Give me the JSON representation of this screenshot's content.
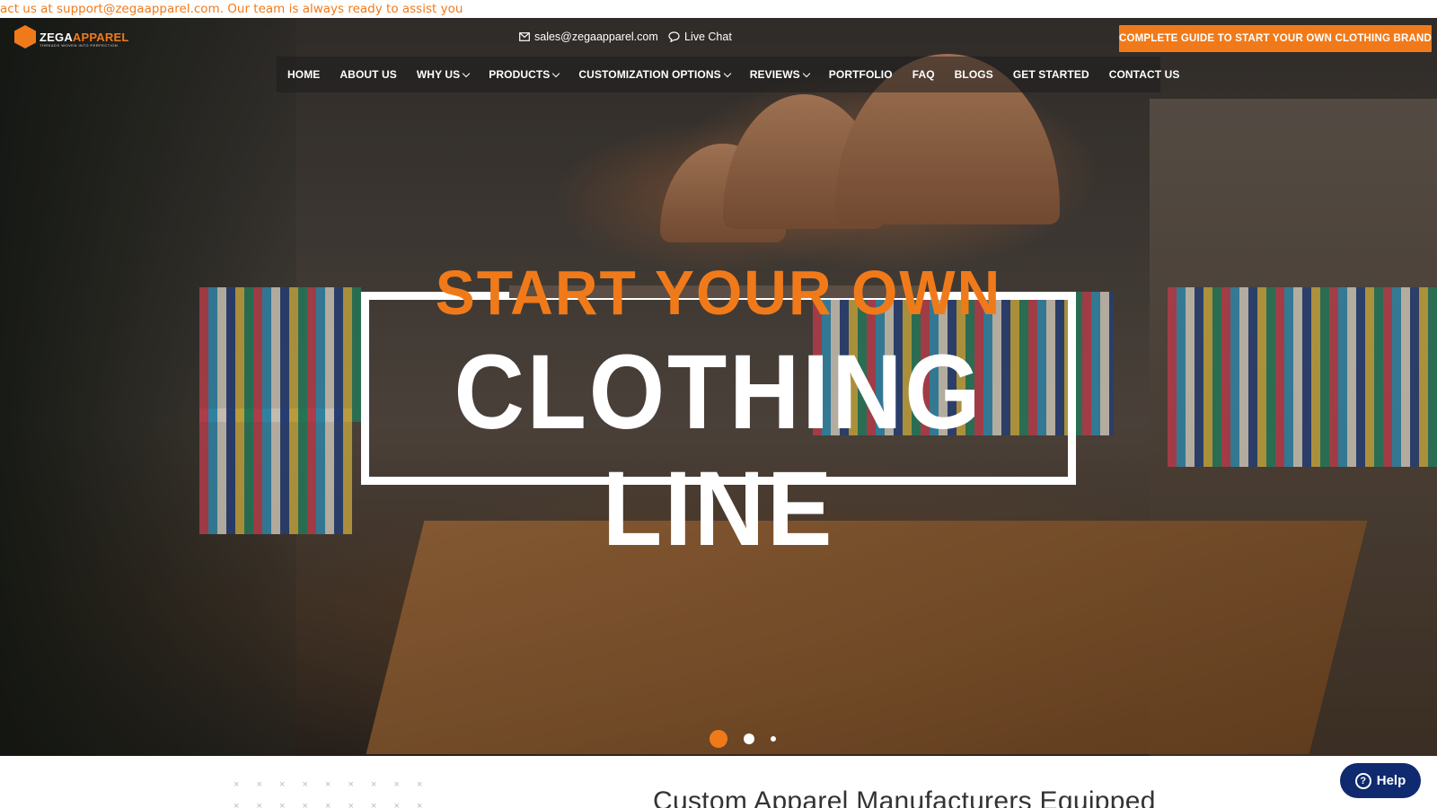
{
  "ticker": {
    "text": "act us at support@zegaapparel.com. Our team is always ready to assist you"
  },
  "brand": {
    "name_part1": "ZEGA",
    "name_part2": "APPAREL",
    "tagline": "THREADS WOVEN INTO PERFECTION"
  },
  "contact": {
    "email": "sales@zegaapparel.com",
    "chat": "Live Chat"
  },
  "guide_button": "COMPLETE GUIDE TO START YOUR OWN CLOTHING BRAND",
  "nav": {
    "home": "HOME",
    "about": "ABOUT US",
    "why_us": "WHY US",
    "products": "PRODUCTS",
    "customization": "CUSTOMIZATION OPTIONS",
    "reviews": "REVIEWS",
    "portfolio": "PORTFOLIO",
    "faq": "FAQ",
    "blogs": "BLOGS",
    "get_started": "GET STARTED",
    "contact": "CONTACT US"
  },
  "hero": {
    "headline_top": "START YOUR OWN",
    "headline_main": "CLOTHING LINE",
    "slide_count": 3,
    "active_slide": 1
  },
  "section": {
    "subheading": "Custom Apparel Manufacturers Equipped"
  },
  "help": {
    "label": "Help"
  },
  "colors": {
    "accent": "#f07a1a",
    "help_bg": "#0f2a6e"
  }
}
